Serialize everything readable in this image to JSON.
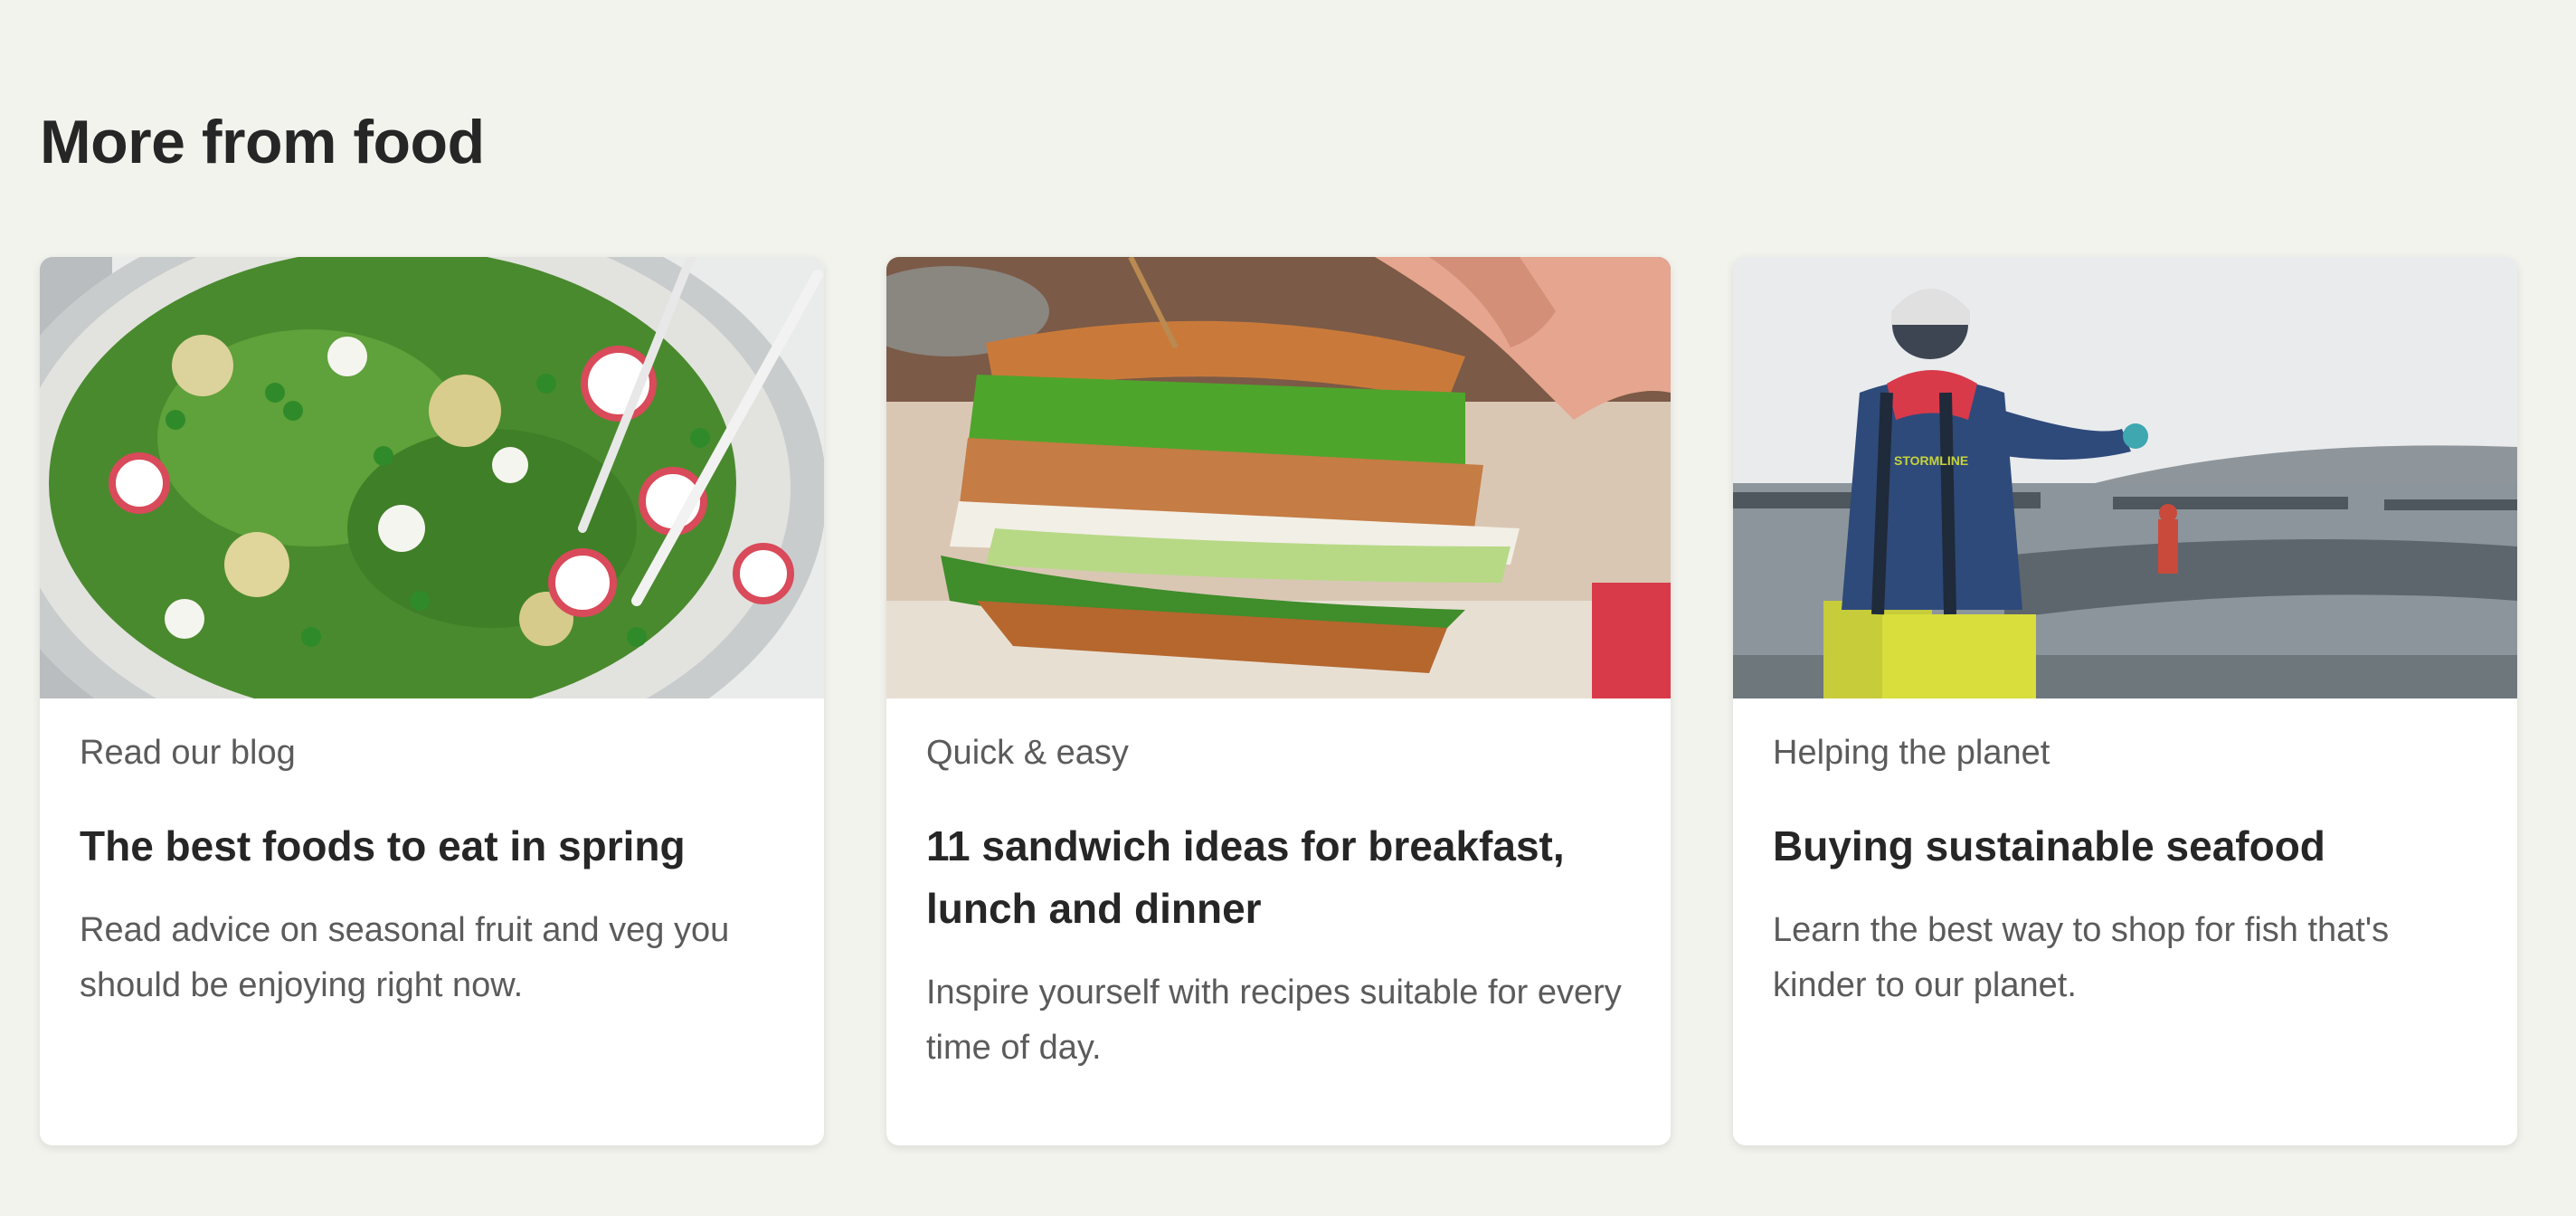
{
  "section": {
    "title": "More from food"
  },
  "cards": [
    {
      "eyebrow": "Read our blog",
      "title": "The best foods to eat in spring",
      "description": "Read advice on seasonal fruit and veg you should be enjoying right now.",
      "image": "spring-salad-photo"
    },
    {
      "eyebrow": "Quick & easy",
      "title": "11 sandwich ideas for breakfast, lunch and dinner",
      "description": "Inspire yourself with recipes suitable for every time of day.",
      "image": "sandwich-photo"
    },
    {
      "eyebrow": "Helping the planet",
      "title": "Buying sustainable seafood",
      "description": "Learn the best way to shop for fish that's kinder to our planet.",
      "image": "fish-farm-worker-photo",
      "image_text": "STORMLINE"
    }
  ],
  "colors": {
    "page_background": "#f3f3ee",
    "card_background": "#ffffff",
    "heading": "#262626",
    "body_text": "#5b5b5b"
  }
}
